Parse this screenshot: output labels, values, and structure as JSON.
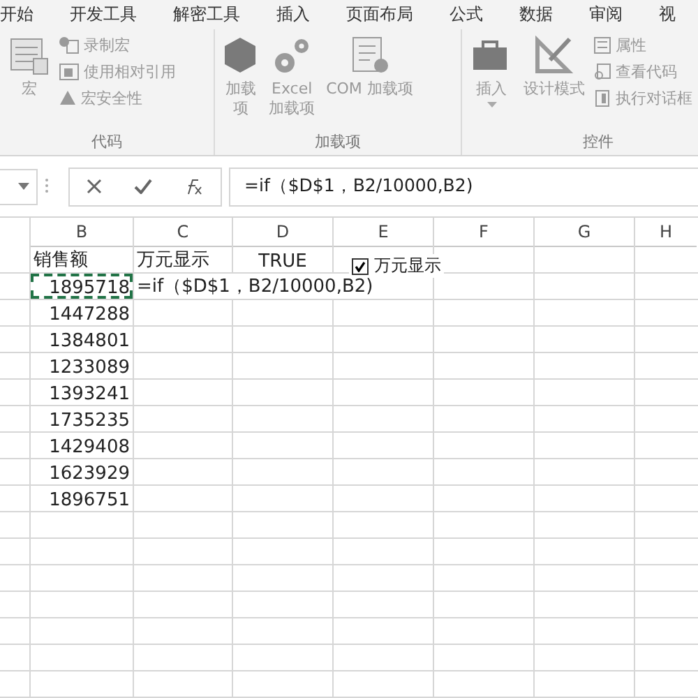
{
  "ribbon": {
    "tabs": [
      {
        "label": "开始"
      },
      {
        "label": "开发工具"
      },
      {
        "label": "解密工具"
      },
      {
        "label": "插入"
      },
      {
        "label": "页面布局"
      },
      {
        "label": "公式"
      },
      {
        "label": "数据"
      },
      {
        "label": "审阅"
      },
      {
        "label": "视"
      }
    ],
    "groups": [
      {
        "label": "代码",
        "items": [
          {
            "kind": "large",
            "label": "宏"
          },
          {
            "kind": "small",
            "label": "录制宏"
          },
          {
            "kind": "small",
            "label": "使用相对引用"
          },
          {
            "kind": "small",
            "label": "宏安全性"
          }
        ]
      },
      {
        "label": "加载项",
        "items": [
          {
            "kind": "narrow",
            "label": "加载项"
          },
          {
            "kind": "large",
            "label": "Excel\n加载项"
          },
          {
            "kind": "large",
            "label": "COM 加载项"
          }
        ]
      },
      {
        "label": "控件",
        "items": [
          {
            "kind": "dropdown",
            "label": "插入"
          },
          {
            "kind": "large",
            "label": "设计模式"
          },
          {
            "kind": "small",
            "label": "属性"
          },
          {
            "kind": "small",
            "label": "查看代码"
          },
          {
            "kind": "small",
            "label": "执行对话框"
          }
        ]
      }
    ]
  },
  "formula_bar": {
    "formula": "=if（$D$1，B2/10000,B2)"
  },
  "sheet": {
    "columns": [
      "B",
      "C",
      "D",
      "E",
      "F",
      "G",
      "H"
    ],
    "checkbox": {
      "label": "万元显示",
      "checked": true
    },
    "rows": [
      {
        "cells": [
          {
            "text": "销售额",
            "kind": "text",
            "copied": false
          },
          {
            "text": "万元显示",
            "kind": "text",
            "copied": false
          },
          {
            "text": "TRUE",
            "kind": "boolean",
            "copied": false
          }
        ]
      },
      {
        "cells": [
          {
            "text": "1895718",
            "kind": "number",
            "copied": true
          },
          {
            "text": "=if（$D$1，B2/10000,B2)",
            "kind": "formula",
            "copied": false
          }
        ]
      },
      {
        "cells": [
          {
            "text": "1447288",
            "kind": "number",
            "copied": false
          }
        ]
      },
      {
        "cells": [
          {
            "text": "1384801",
            "kind": "number",
            "copied": false
          }
        ]
      },
      {
        "cells": [
          {
            "text": "1233089",
            "kind": "number",
            "copied": false
          }
        ]
      },
      {
        "cells": [
          {
            "text": "1393241",
            "kind": "number",
            "copied": false
          }
        ]
      },
      {
        "cells": [
          {
            "text": "1735235",
            "kind": "number",
            "copied": false
          }
        ]
      },
      {
        "cells": [
          {
            "text": "1429408",
            "kind": "number",
            "copied": false
          }
        ]
      },
      {
        "cells": [
          {
            "text": "1623929",
            "kind": "number",
            "copied": false
          }
        ]
      },
      {
        "cells": [
          {
            "text": "1896751",
            "kind": "number",
            "copied": false
          }
        ]
      }
    ]
  }
}
